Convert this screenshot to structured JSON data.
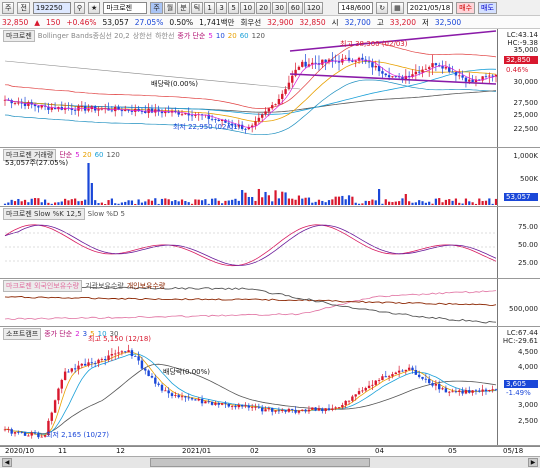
{
  "toolbar": {
    "market": "주",
    "mode": "전",
    "code": "192250",
    "name": "마크로젠",
    "periods": [
      "주",
      "월",
      "분",
      "틱",
      "1",
      "3",
      "5",
      "10",
      "20",
      "30",
      "60",
      "120"
    ],
    "count": "148/600",
    "date": "2021/05/18",
    "buy": "매수",
    "sell": "매도"
  },
  "quote": {
    "price": "32,850",
    "arrow": "▲",
    "change": "150",
    "pct": "+0.46%",
    "volume": "53,057",
    "vol_ratio": "27.05%",
    "turnover": "0.50%",
    "amount": "1,741백만",
    "amount_label": "회우선",
    "open": "32,900",
    "open_label": "32,850",
    "high_label": "시",
    "high": "32,700",
    "low_label": "고",
    "low": "33,200",
    "close_label": "저",
    "close": "32,500"
  },
  "pane1": {
    "title": "마크로젠",
    "bb": "Bollinger Bands종심선 20,2",
    "bb_up": "상한선",
    "bb_dn": "하한선",
    "ma_label": "종가 단순",
    "ma": [
      "5",
      "10",
      "20",
      "60",
      "120"
    ],
    "lc": "LC:43.14",
    "hc": "HC:-9.38",
    "axis": [
      "35,000",
      "32,500",
      "30,000",
      "27,500",
      "25,000",
      "22,500"
    ],
    "price_chip": "32,850",
    "pct_chip": "0.46%",
    "high_note": "최고 38,300 (02/03)",
    "low_note": "최저 22,950 (02/01)",
    "div_note": "배당락(0.00%)"
  },
  "pane2": {
    "title": "마크로젠 거래량",
    "ma_label": "단순",
    "ma": [
      "5",
      "20",
      "60",
      "120"
    ],
    "vol_text": "53,057주(27.05%)",
    "axis": [
      "1,000K",
      "500K"
    ],
    "chip": "53,057"
  },
  "pane3": {
    "title": "마크로젠 Slow %K 12,5",
    "d": "Slow %D 5",
    "axis": [
      "75.00",
      "50.00",
      "25.00"
    ]
  },
  "pane4": {
    "title": "마크로젠 외국인보유수량",
    "inst": "기관보유수량",
    "indiv": "개인보유수량",
    "axis": [
      "500,000"
    ]
  },
  "pane5": {
    "title": "소프트캠프",
    "ma_label": "종가 단순",
    "ma": [
      "2",
      "3",
      "5",
      "10",
      "30"
    ],
    "lc": "LC:67.44",
    "hc": "HC:-29.61",
    "axis": [
      "4,500",
      "4,000",
      "3,500",
      "3,000",
      "2,500"
    ],
    "price_chip": "3,605",
    "pct_chip": "-1.49%",
    "high_note": "최고 5,150 (12/18)",
    "low_note": "최저 2,165 (10/27)",
    "div_note": "배당락(0.00%)"
  },
  "xaxis": [
    "2020/10",
    "11",
    "12",
    "2021/01",
    "02",
    "03",
    "04",
    "05",
    "05/18"
  ],
  "colors": {
    "up": "#d8182e",
    "down": "#1a47d8",
    "ma5": "#d81bd8",
    "ma20": "#e8a000",
    "ma60": "#1aa0d8",
    "ma120": "#555555",
    "bb": "#a0a0a0"
  }
}
